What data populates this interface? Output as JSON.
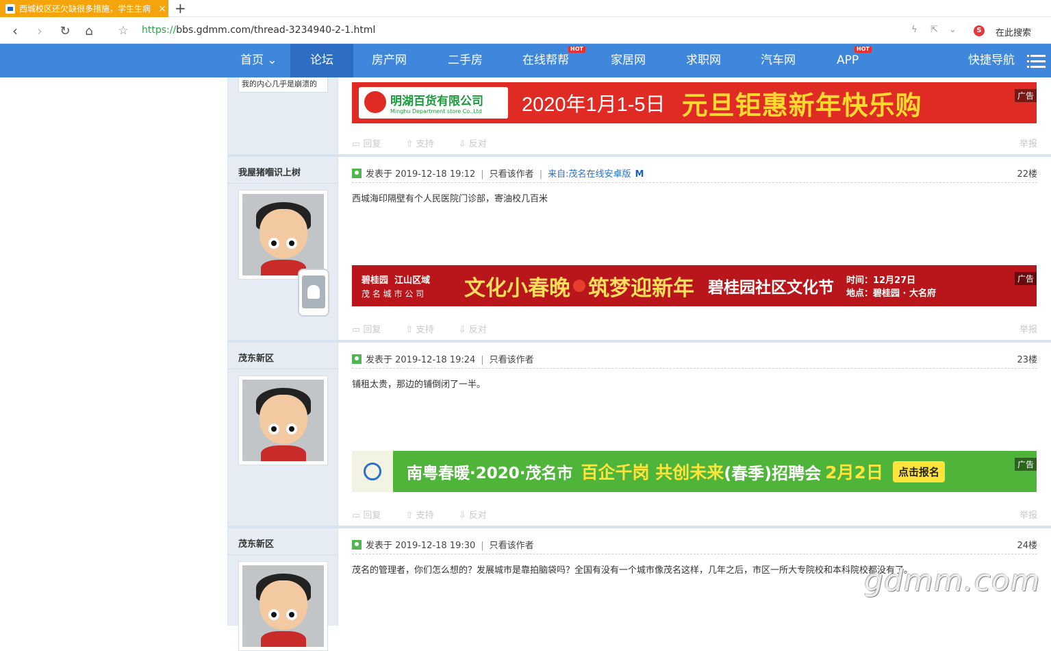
{
  "browser": {
    "tab_title": "西城校区还欠缺很多措施，学生生病",
    "tab_close": "×",
    "new_tab": "+",
    "url_scheme": "https://",
    "url_rest": "bbs.gdmm.com/thread-3234940-2-1.html",
    "search_text": "在此搜索",
    "search_logo": "S"
  },
  "nav": {
    "items": [
      {
        "label": "首页"
      },
      {
        "label": "论坛"
      },
      {
        "label": "房产网"
      },
      {
        "label": "二手房"
      },
      {
        "label": "在线帮帮",
        "badge": "HOT"
      },
      {
        "label": "家居网"
      },
      {
        "label": "求职网"
      },
      {
        "label": "汽车网"
      },
      {
        "label": "APP",
        "badge": "HOT"
      },
      {
        "label": "快捷导航"
      }
    ]
  },
  "prev_post": {
    "sidebar_text": "我的内心几乎是崩溃的",
    "ad": {
      "brand": "明湖百货有限公司",
      "brand_en": "Minghu Department store Co.,Ltd",
      "text1": "2020年1月1-5日",
      "text2": "元旦钜惠新年快乐购",
      "badge": "广告"
    },
    "actions": {
      "reply": "回复",
      "support": "支持",
      "oppose": "反对",
      "report": "举报"
    }
  },
  "posts": [
    {
      "author": "我屋猪嗰识上树",
      "posted": "发表于 2019-12-18 19:12",
      "only_author": "只看该作者",
      "from": "来自:茂名在线安卓版",
      "floor": "22楼",
      "body": "西城海印隔壁有个人民医院门诊部，寄油校几百米",
      "ad": {
        "brand": "碧桂园",
        "brand2": "江山区域",
        "sub": "茂 名 城 市 公 司",
        "text1": "文化小春晚",
        "text2": "筑梦迎新年",
        "text3": "碧桂园社区文化节",
        "time": "时间：12月27日",
        "place": "地点：碧桂园 · 大名府",
        "badge": "广告"
      },
      "actions": {
        "reply": "回复",
        "support": "支持",
        "oppose": "反对",
        "report": "举报"
      }
    },
    {
      "author": "茂东新区",
      "posted": "发表于 2019-12-18 19:24",
      "only_author": "只看该作者",
      "floor": "23楼",
      "body": "铺租太贵，那边的铺倒闭了一半。",
      "ad": {
        "text1": "南粤春暖·2020·茂名市",
        "text2": "百企千岗 共创未来",
        "text3": "(春季)招聘会",
        "text4": "2月2日",
        "button": "点击报名",
        "badge": "广告"
      },
      "actions": {
        "reply": "回复",
        "support": "支持",
        "oppose": "反对",
        "report": "举报"
      }
    },
    {
      "author": "茂东新区",
      "posted": "发表于 2019-12-18 19:30",
      "only_author": "只看该作者",
      "floor": "24楼",
      "body": "茂名的管理者，你们怎么想的？发展城市是靠拍脑袋吗？全国有没有一个城市像茂名这样，几年之后，市区一所大专院校和本科院校都没有了。"
    }
  ],
  "watermark": "gdmm.com",
  "colors": {
    "nav_bg": "#3f87dd",
    "tab_bg": "#f5a40b",
    "sidebar_bg": "#e5ecf3"
  }
}
